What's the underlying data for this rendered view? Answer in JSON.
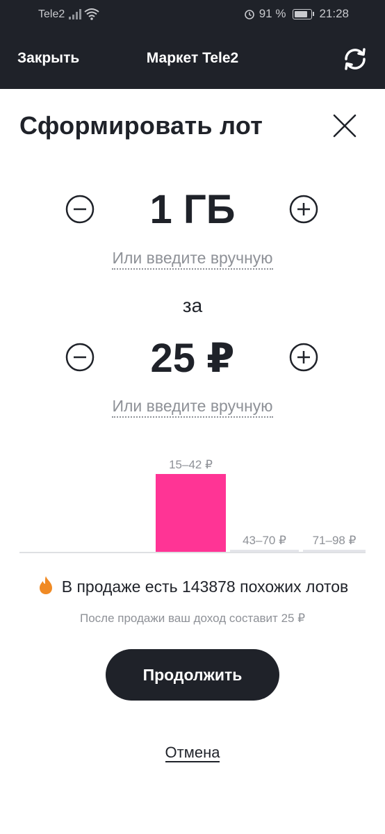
{
  "status_bar": {
    "carrier": "Tele2",
    "battery_percent": "91 %",
    "battery_level": 0.91,
    "time": "21:28"
  },
  "header": {
    "close_label": "Закрыть",
    "title": "Маркет Tele2",
    "refresh_icon": "refresh-icon"
  },
  "page": {
    "title": "Сформировать лот"
  },
  "data_stepper": {
    "value": "1 ГБ",
    "manual_link": "Или введите вручную"
  },
  "separator_word": "за",
  "price_stepper": {
    "value": "25 ₽",
    "manual_link": "Или введите вручную"
  },
  "price_histogram": {
    "bins": [
      {
        "label": "15–42 ₽",
        "highlighted": true,
        "relative_height": 1.0
      },
      {
        "label": "43–70 ₽",
        "highlighted": false,
        "relative_height": 0.02
      },
      {
        "label": "71–98 ₽",
        "highlighted": false,
        "relative_height": 0.02
      }
    ],
    "highlight_color": "#ff3495",
    "muted_color": "#e4e5ea"
  },
  "offers": {
    "text": "В продаже есть 143878 похожих лотов",
    "income": "После продажи ваш доход составит 25 ₽"
  },
  "actions": {
    "continue_label": "Продолжить",
    "cancel_label": "Отмена"
  },
  "colors": {
    "dark": "#1f2229",
    "accent_pink": "#ff3495",
    "fire_orange": "#f08a24",
    "muted_text": "#8e9197"
  }
}
